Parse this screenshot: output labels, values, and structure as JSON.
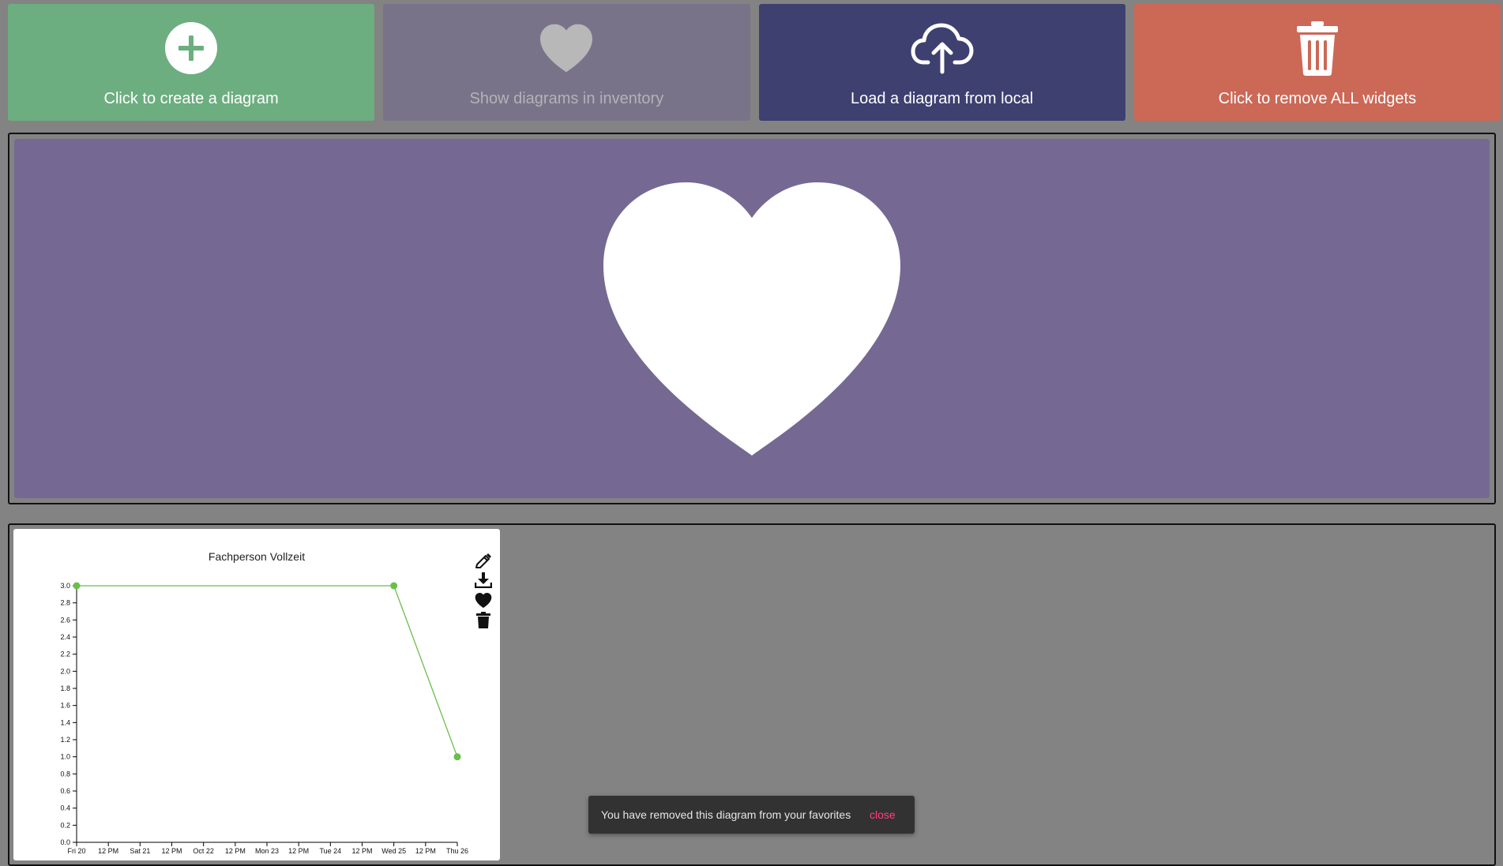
{
  "toolbar": {
    "create_label": "Click to create a diagram",
    "inventory_label": "Show diagrams in inventory",
    "load_label": "Load a diagram from local",
    "remove_label": "Click to remove ALL widgets"
  },
  "icons": {
    "create": "plus-circle-icon",
    "inventory": "heart-icon",
    "load": "cloud-upload-icon",
    "remove": "trash-icon",
    "favorites": "heart-icon"
  },
  "colors": {
    "create": "#6cae80",
    "inventory": "#79738a",
    "load": "#3e4070",
    "remove": "#cc6856",
    "favorites_panel": "#756993",
    "series": "#6abf4b",
    "snackbar_action": "#ff4081"
  },
  "widget": {
    "title": "Fachperson Vollzeit",
    "actions": [
      "pencil-icon",
      "download-icon",
      "heart-icon",
      "trash-icon"
    ]
  },
  "snackbar": {
    "message": "You have removed this diagram from your favorites",
    "action": "close"
  },
  "chart_data": {
    "type": "line",
    "title": "Fachperson Vollzeit",
    "xlabel": "",
    "ylabel": "",
    "x_ticks": [
      "Fri 20",
      "12 PM",
      "Sat 21",
      "12 PM",
      "Oct 22",
      "12 PM",
      "Mon 23",
      "12 PM",
      "Tue 24",
      "12 PM",
      "Wed 25",
      "12 PM",
      "Thu 26"
    ],
    "y_ticks": [
      "0.0",
      "0.2",
      "0.4",
      "0.6",
      "0.8",
      "1.0",
      "1.2",
      "1.4",
      "1.6",
      "1.8",
      "2.0",
      "2.2",
      "2.4",
      "2.6",
      "2.8",
      "3.0"
    ],
    "ylim": [
      0,
      3
    ],
    "series": [
      {
        "x": [
          "Fri 20",
          "Wed 25",
          "Thu 26"
        ],
        "values": [
          3,
          3,
          1
        ]
      }
    ],
    "grid": false
  }
}
